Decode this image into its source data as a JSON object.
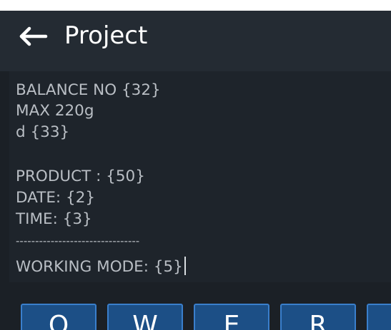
{
  "header": {
    "back_icon": "arrow-left-icon",
    "title": "Project"
  },
  "editor": {
    "lines": [
      "BALANCE NO {32}",
      "MAX 220g",
      "d {33}",
      "",
      "PRODUCT : {50}",
      "DATE: {2}",
      "TIME: {3}",
      "--------------------------------",
      "WORKING MODE: {5}"
    ]
  },
  "keyboard": {
    "keys": [
      "Q",
      "W",
      "E",
      "R"
    ]
  },
  "colors": {
    "background": "#1b2026",
    "header": "#242b33",
    "text": "#b9bec4",
    "key_fill": "#1c4f86",
    "key_border": "#3a7fcc"
  }
}
